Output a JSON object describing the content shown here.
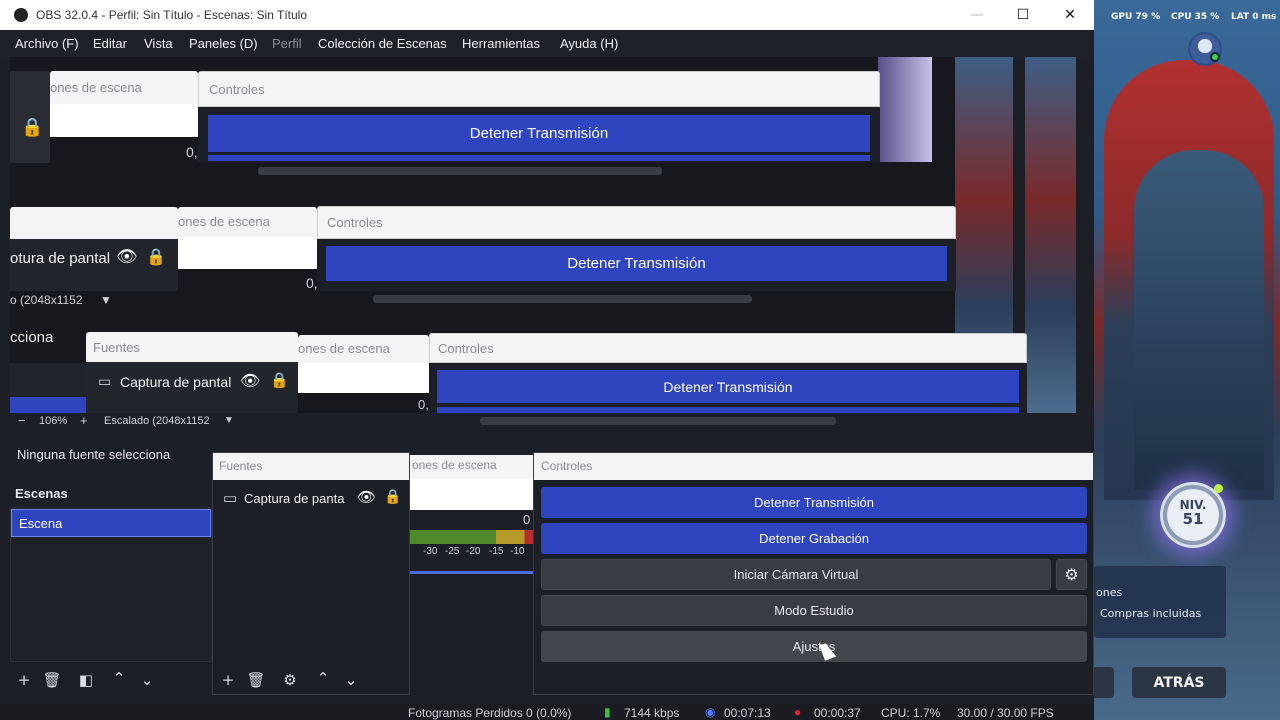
{
  "hud": {
    "gpu": "GPU 79 %",
    "cpu": "CPU 35 %",
    "lat": "LAT 0 ms"
  },
  "game": {
    "level_label": "NIV.",
    "level_value": "51",
    "panel_line1": "ones",
    "panel_line2": "Compras incluidas",
    "back_button": "ATRÁS"
  },
  "window": {
    "title": "OBS 32.0.4 - Perfil: Sin Título - Escenas: Sin Título",
    "minimize": "—",
    "maximize": "☐",
    "close": "✕"
  },
  "menu": [
    {
      "label": "Archivo (F)"
    },
    {
      "label": "Editar"
    },
    {
      "label": "Vista"
    },
    {
      "label": "Paneles (D)"
    },
    {
      "label": "Perfil"
    },
    {
      "label": "Colección de Escenas"
    },
    {
      "label": "Herramientas"
    },
    {
      "label": "Ayuda (H)"
    }
  ],
  "preview": {
    "transiciones": "ones de escena",
    "controles": "Controles",
    "stop_stream": "Detener Transmisión",
    "fuentes": "Fuentes",
    "captura": "Captura de pantal",
    "captura2": "otura de pantal",
    "ninguna": "Ninguna fuente selecciona",
    "ninguna_short": "cciona",
    "escalado": "Escalado (2048x1152",
    "escalado_short": "o (2048x1152",
    "zoom": "106%",
    "zero": "0,",
    "zero2": "0"
  },
  "escenas": {
    "title": "Escenas",
    "items": [
      "Escena"
    ]
  },
  "fuentes": {
    "title": "Fuentes",
    "items": [
      "Captura de panta"
    ]
  },
  "mixer": {
    "header": "ones de escena",
    "zero": "0",
    "ticks": [
      "-30",
      "-25",
      "-20",
      "-15",
      "-10"
    ]
  },
  "controles": {
    "title": "Controles",
    "stop_stream": "Detener Transmisión",
    "stop_record": "Detener Grabación",
    "virtual_cam": "Iniciar Cámara Virtual",
    "studio": "Modo Estudio",
    "settings": "Ajustes"
  },
  "status": {
    "dropped": "Fotogramas Perdidos 0 (0.0%)",
    "bitrate": "7144 kbps",
    "stream_time": "00:07:13",
    "rec_time": "00:00:37",
    "cpu": "CPU: 1.7%",
    "fps": "30.00 / 30.00 FPS"
  }
}
